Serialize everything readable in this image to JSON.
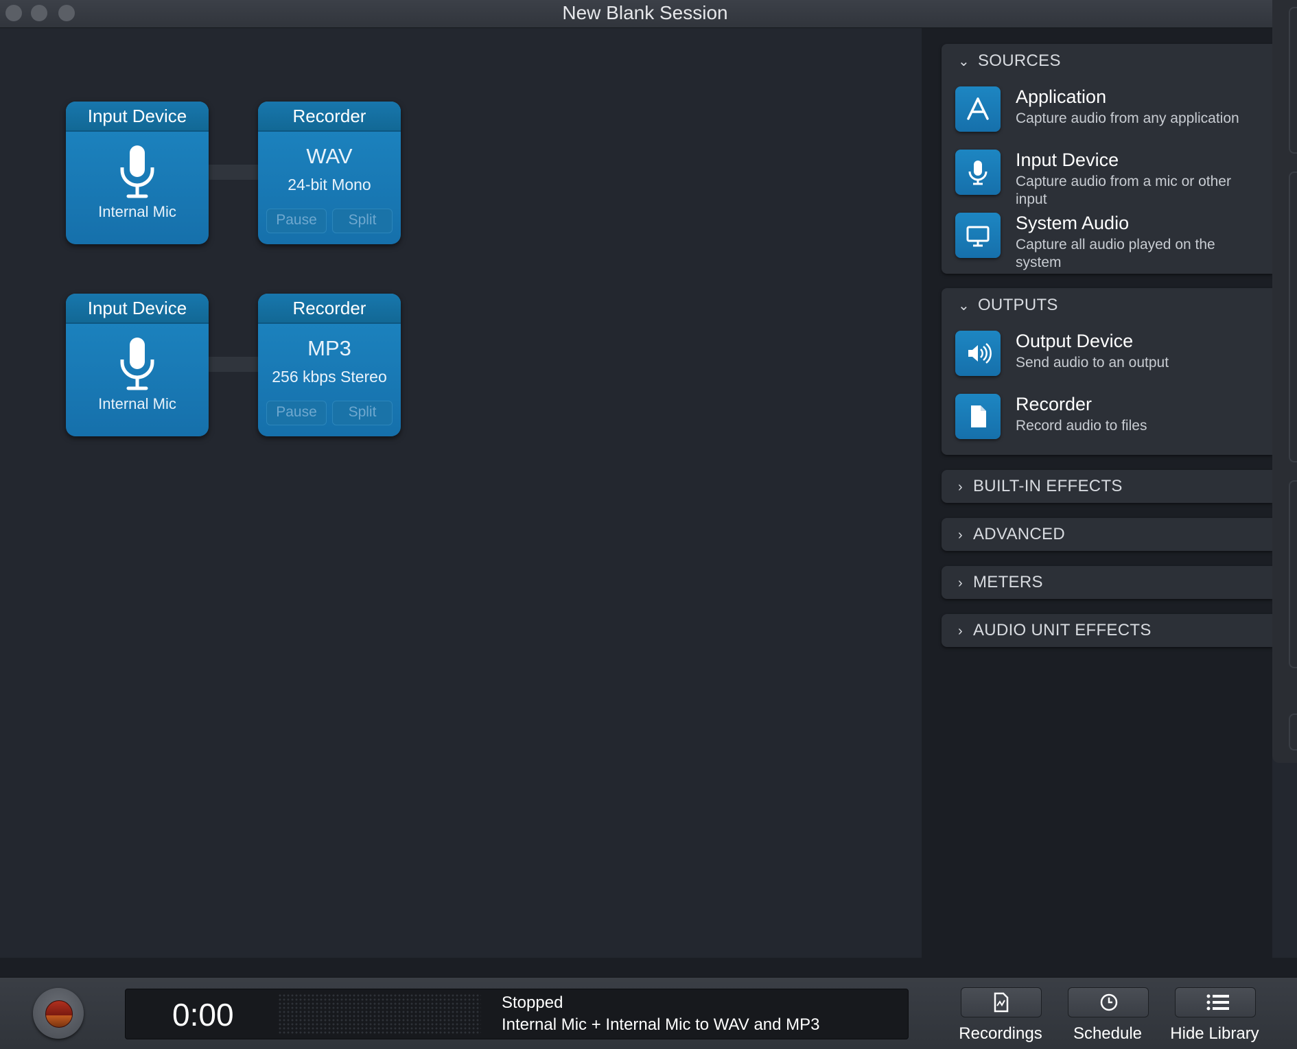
{
  "window": {
    "title": "New Blank Session"
  },
  "pipelines": [
    {
      "input": {
        "header": "Input Device",
        "device": "Internal Mic"
      },
      "recorder": {
        "header": "Recorder",
        "format": "WAV",
        "detail": "24-bit Mono",
        "pause": "Pause",
        "split": "Split"
      }
    },
    {
      "input": {
        "header": "Input Device",
        "device": "Internal Mic"
      },
      "recorder": {
        "header": "Recorder",
        "format": "MP3",
        "detail": "256 kbps Stereo",
        "pause": "Pause",
        "split": "Split"
      }
    }
  ],
  "library": {
    "sources": {
      "title": "SOURCES",
      "items": [
        {
          "title": "Application",
          "desc": "Capture audio from any application",
          "icon": "app-store-icon"
        },
        {
          "title": "Input Device",
          "desc": "Capture audio from a mic or other input",
          "icon": "microphone-icon"
        },
        {
          "title": "System Audio",
          "desc": "Capture all audio played on the system",
          "icon": "monitor-icon"
        }
      ]
    },
    "outputs": {
      "title": "OUTPUTS",
      "items": [
        {
          "title": "Output Device",
          "desc": "Send audio to an output",
          "icon": "speaker-icon"
        },
        {
          "title": "Recorder",
          "desc": "Record audio to files",
          "icon": "document-icon"
        }
      ]
    },
    "collapsed": [
      "BUILT-IN EFFECTS",
      "ADVANCED",
      "METERS",
      "AUDIO UNIT EFFECTS"
    ]
  },
  "transport": {
    "time": "0:00",
    "status": "Stopped",
    "description": "Internal Mic + Internal Mic to WAV and MP3"
  },
  "toolbar": {
    "recordings": "Recordings",
    "schedule": "Schedule",
    "hide_library": "Hide Library"
  },
  "colors": {
    "accent": "#1b7fb9",
    "background": "#23272f",
    "record": "#a52a1a"
  }
}
